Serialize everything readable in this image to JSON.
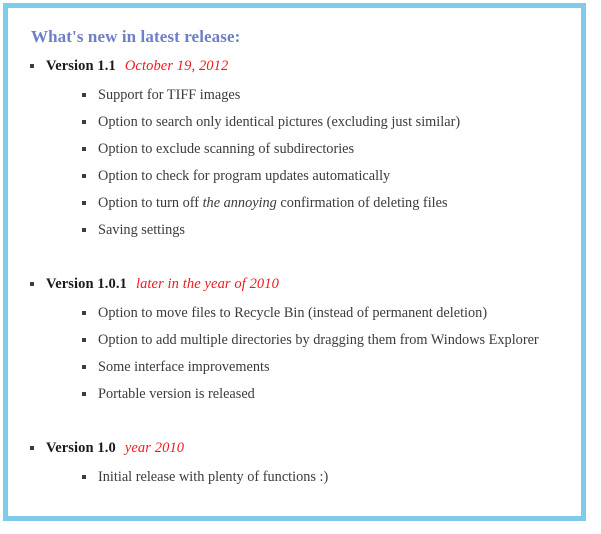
{
  "panel": {
    "border_color": "#7fcbec",
    "background_color": "#ffffff"
  },
  "heading": {
    "text": "What's new in latest release:",
    "color": "#6d80c6"
  },
  "colors": {
    "date_red": "#ee1b22",
    "body_text": "#3b3b3b",
    "version_text": "#1a1a1a",
    "bullet": "#3d3d3d"
  },
  "releases": [
    {
      "version": "Version 1.1",
      "date": "October 19, 2012",
      "features": [
        {
          "pre": "Support for TIFF images",
          "em": "",
          "post": ""
        },
        {
          "pre": "Option to search only identical pictures (excluding just similar)",
          "em": "",
          "post": ""
        },
        {
          "pre": "Option to exclude scanning of subdirectories",
          "em": "",
          "post": ""
        },
        {
          "pre": "Option to check for program updates automatically",
          "em": "",
          "post": ""
        },
        {
          "pre": "Option to turn off ",
          "em": "the annoying",
          "post": " confirmation of deleting files"
        },
        {
          "pre": "Saving settings",
          "em": "",
          "post": ""
        }
      ]
    },
    {
      "version": "Version 1.0.1",
      "date": "later in the year of 2010",
      "features": [
        {
          "pre": "Option to move files to Recycle Bin (instead of permanent deletion)",
          "em": "",
          "post": ""
        },
        {
          "pre": "Option to add multiple directories by dragging them from Windows Explorer",
          "em": "",
          "post": ""
        },
        {
          "pre": "Some interface improvements",
          "em": "",
          "post": ""
        },
        {
          "pre": "Portable version is released",
          "em": "",
          "post": ""
        }
      ]
    },
    {
      "version": "Version 1.0",
      "date": "year 2010",
      "features": [
        {
          "pre": "Initial release with plenty of functions :)",
          "em": "",
          "post": ""
        }
      ]
    }
  ]
}
